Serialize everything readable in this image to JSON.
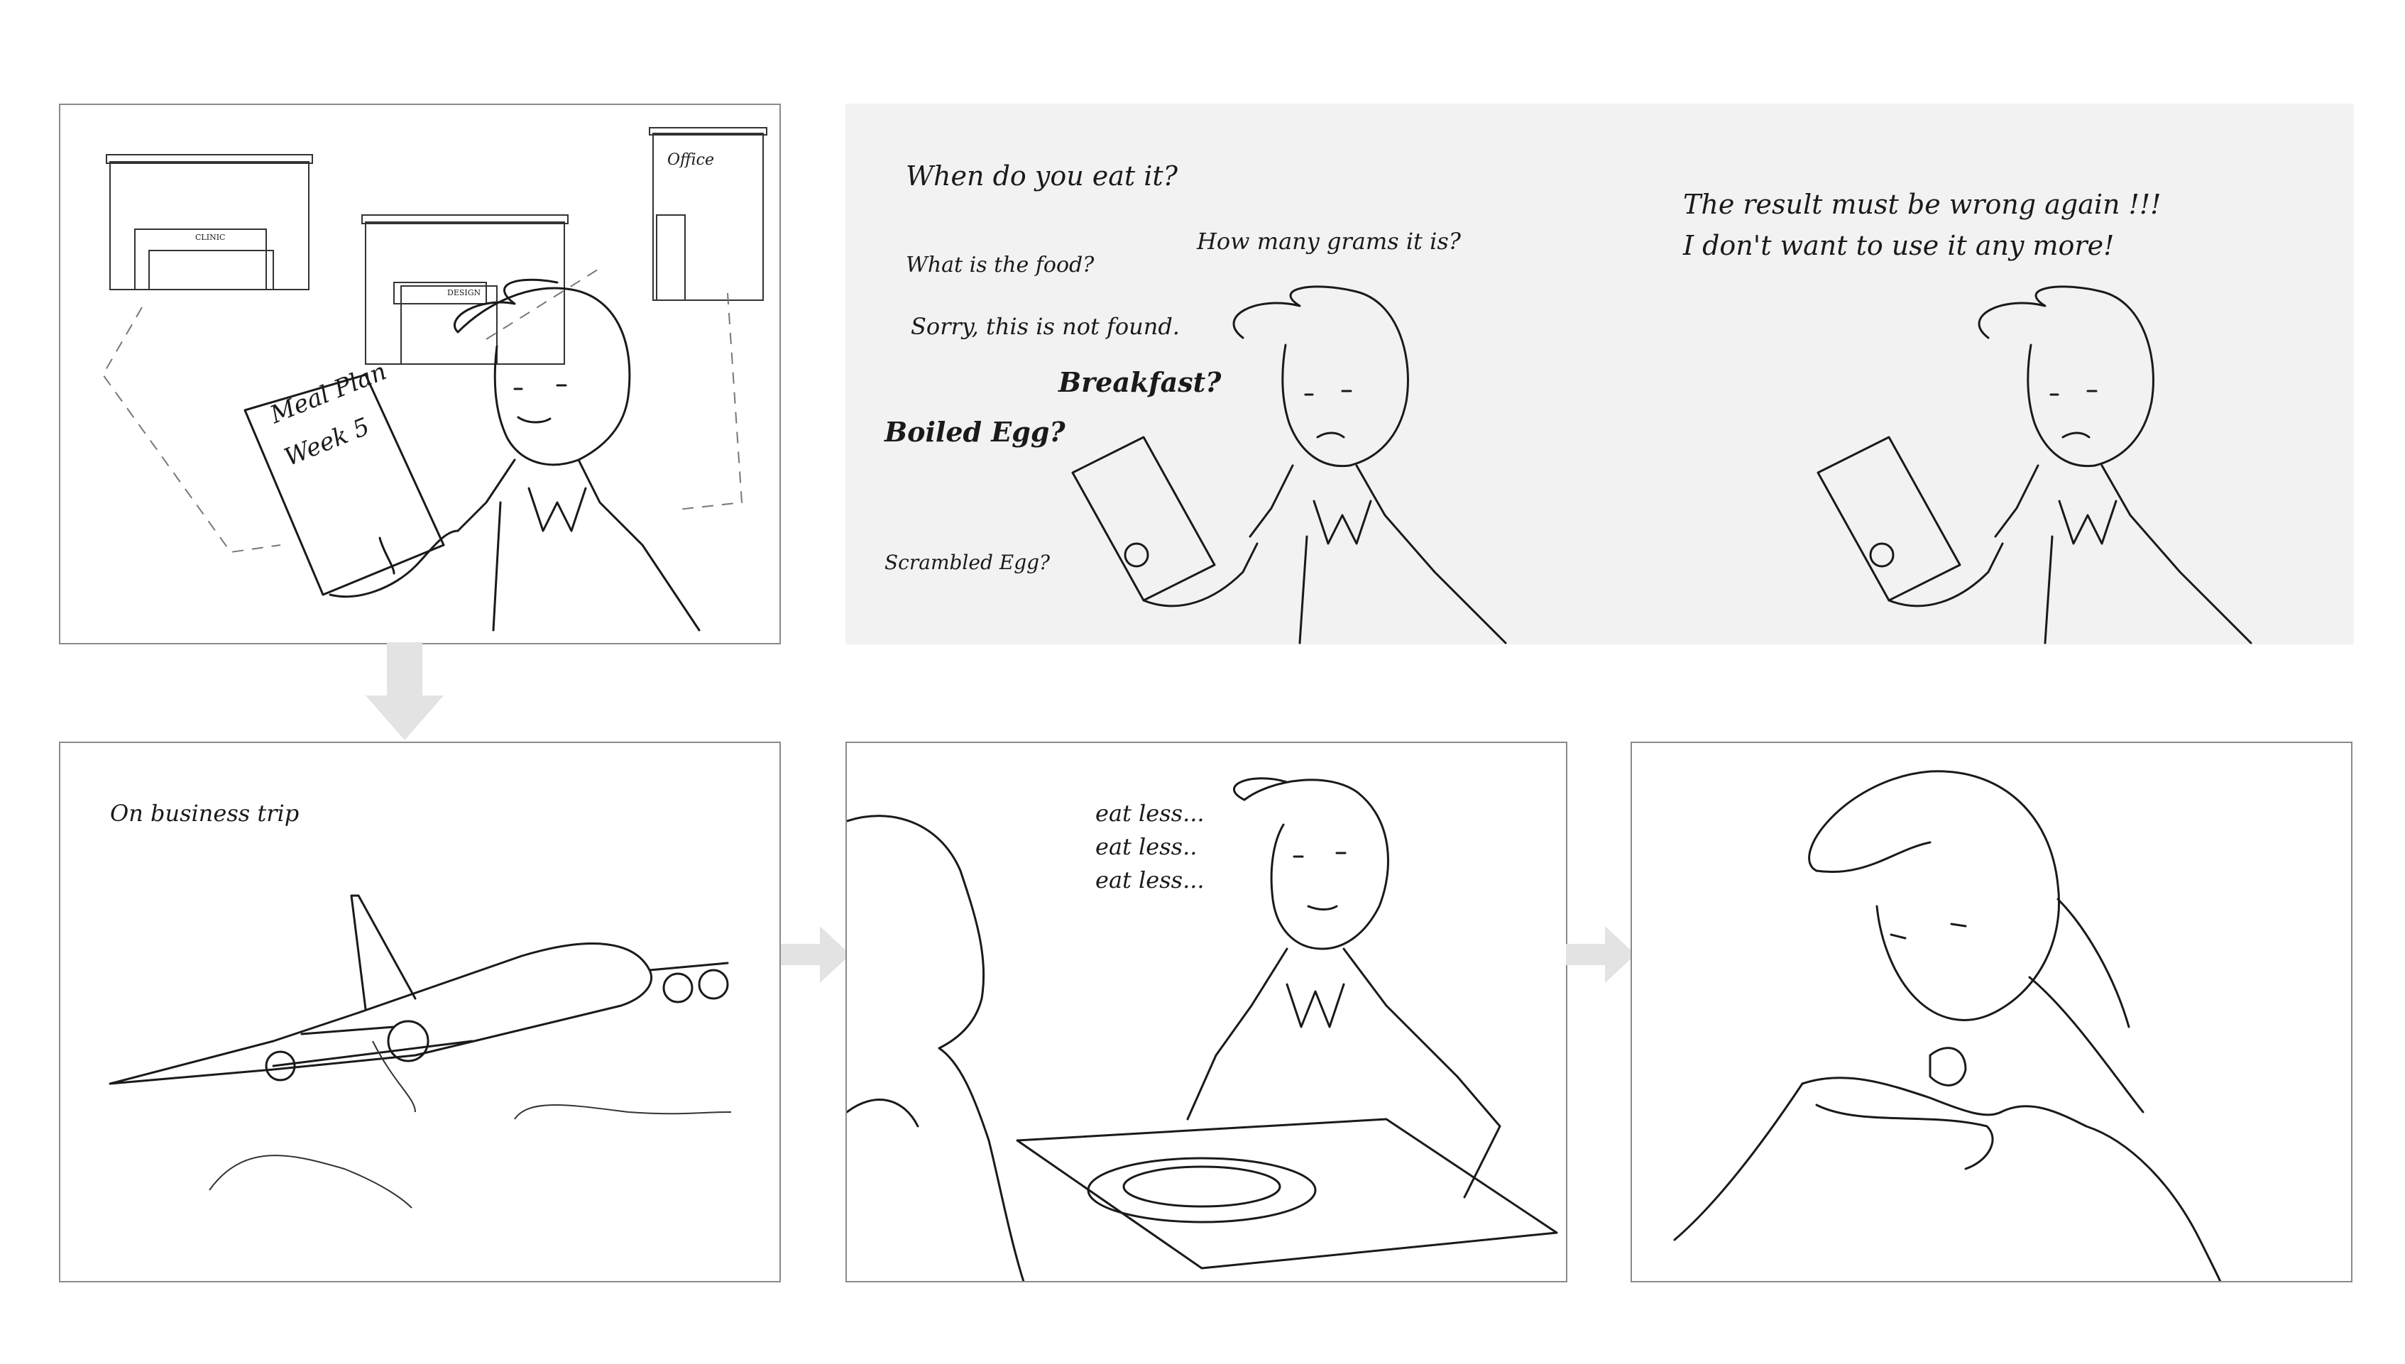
{
  "panel1": {
    "office_label": "Office",
    "clinic_label": "CLINIC",
    "design_label": "DESIGN",
    "meal_plan_line1": "Meal Plan",
    "meal_plan_line2": "Week 5"
  },
  "panel2": {
    "q_when": "When do you eat it?",
    "q_food": "What is the food?",
    "q_grams": "How many grams it is?",
    "msg_not_found": "Sorry, this is not found.",
    "breakfast": "Breakfast?",
    "boiled_egg": "Boiled Egg?",
    "scrambled_egg": "Scrambled Egg?",
    "result_line1": "The result must be wrong again !!!",
    "result_line2": "I don't want to use it any more!"
  },
  "panel3": {
    "caption": "On business trip"
  },
  "panel4": {
    "line1": "eat less...",
    "line2": "eat less..",
    "line3": "eat less..."
  },
  "colors": {
    "panel_border": "#8a8a8a",
    "grey_panel_bg": "#f2f2f2",
    "arrow": "#e3e3e3",
    "ink": "#1a1a1a"
  },
  "icons": [
    "down-arrow-icon",
    "right-arrow-icon"
  ]
}
